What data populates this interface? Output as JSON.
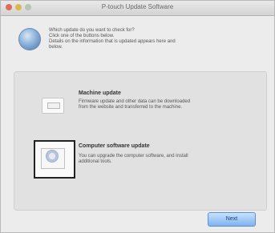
{
  "window": {
    "title": "P-touch Update Software"
  },
  "intro": {
    "lines": [
      "Which update do you want to check for?",
      "Click one of the buttons below.",
      "Details on the information that is updated appears here and",
      "below."
    ]
  },
  "options": [
    {
      "title": "Machine update",
      "desc_lines": [
        "Firmware update and other data can be downloaded",
        "from the website and transferred to the machine."
      ],
      "icon": "machine-icon"
    },
    {
      "title": "Computer software update",
      "desc_lines": [
        "You can upgrade the computer software, and install",
        "additional tools."
      ],
      "icon": "software-cd-icon",
      "selected": true
    }
  ],
  "buttons": {
    "next_label": "Next"
  },
  "colors": {
    "panel": "#e1e1e1",
    "window": "#ececec",
    "next_button": "#7fb3ef"
  }
}
